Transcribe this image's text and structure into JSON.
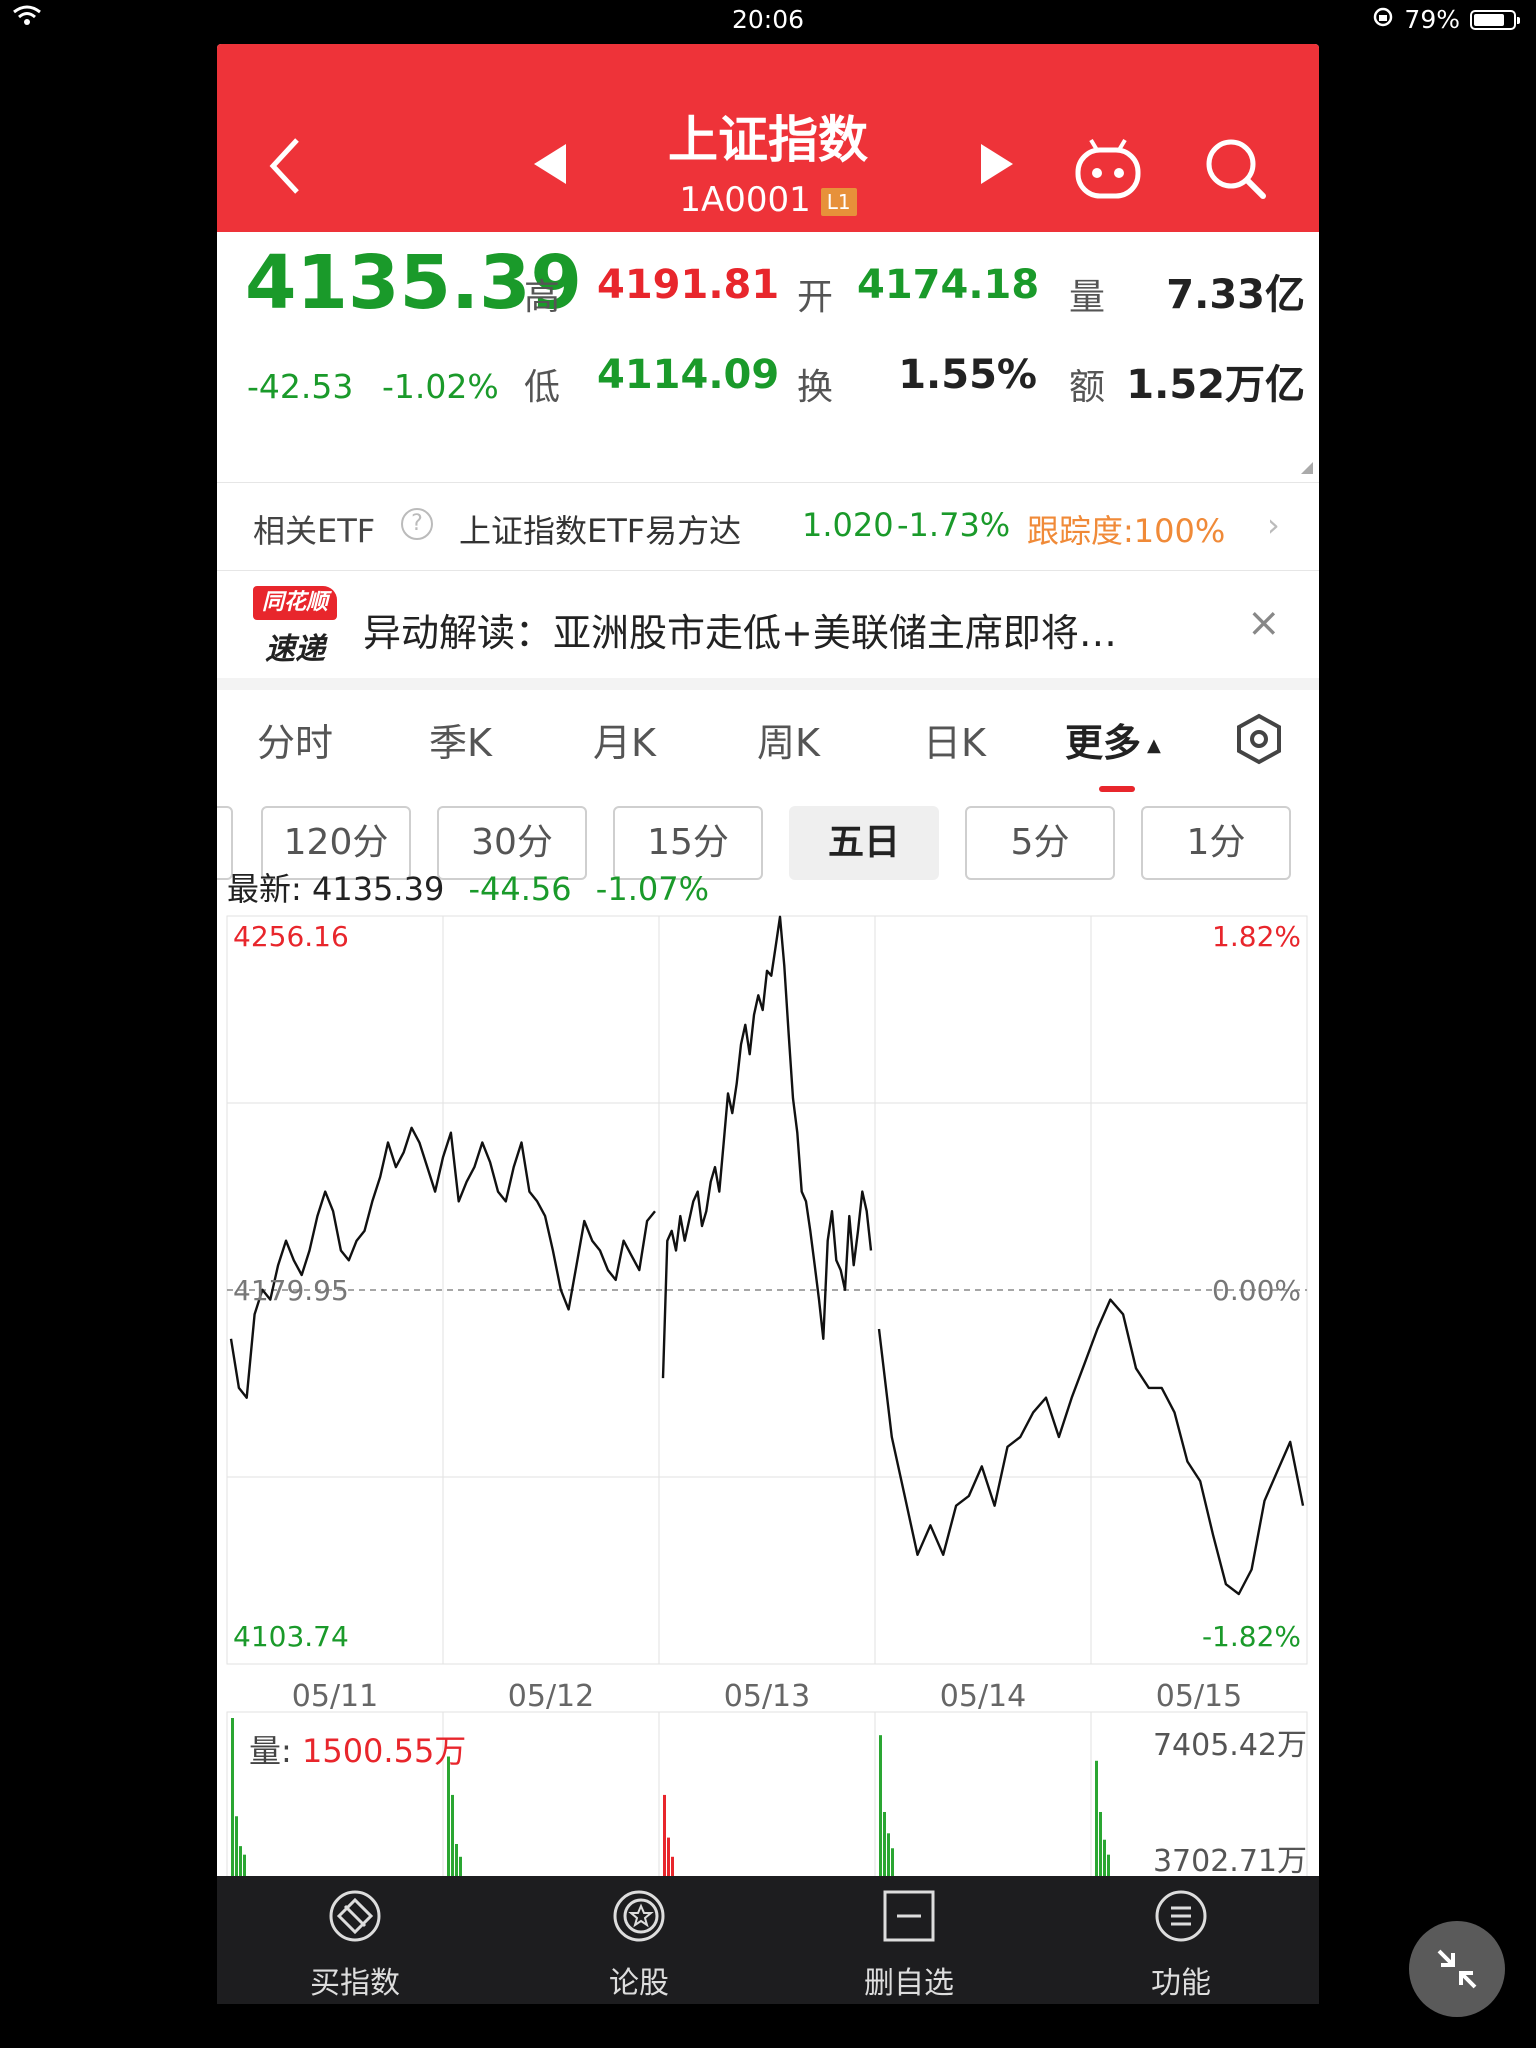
{
  "status": {
    "time": "20:06",
    "battery": "79%",
    "battery_level": 0.79
  },
  "header": {
    "title": "上证指数",
    "code": "1A0001",
    "badge": "L1"
  },
  "quote": {
    "price": "4135.39",
    "change": "-42.53",
    "change_pct": "-1.02%",
    "high_label": "高",
    "high": "4191.81",
    "open_label": "开",
    "open": "4174.18",
    "vol_label": "量",
    "vol": "7.33亿",
    "low_label": "低",
    "low": "4114.09",
    "turnover_label": "换",
    "turnover": "1.55%",
    "amount_label": "额",
    "amount": "1.52万亿"
  },
  "etf": {
    "label": "相关ETF",
    "help": "?",
    "name": "上证指数ETF易方达",
    "price": "1.020",
    "pct": "-1.73%",
    "tracking": "跟踪度:100%"
  },
  "news": {
    "logo_top": "同花顺",
    "logo_bottom": "速递",
    "text": "异动解读：亚洲股市走低+美联储主席即将…",
    "close": "×"
  },
  "tabs": [
    "分时",
    "季K",
    "月K",
    "周K",
    "日K",
    "更多"
  ],
  "active_tab": "更多",
  "subtabs": [
    "120分",
    "30分",
    "15分",
    "五日",
    "5分",
    "1分"
  ],
  "active_subtab": "五日",
  "latest": {
    "label": "最新:",
    "value": "4135.39",
    "chg": "-44.56",
    "pct": "-1.07%"
  },
  "chart_data": {
    "type": "line",
    "series": [
      {
        "values": [
          4170,
          4160,
          4158,
          4175,
          4180,
          4178,
          4185,
          4190,
          4186,
          4183,
          4188,
          4195,
          4200,
          4196,
          4188,
          4186,
          4190,
          4192,
          4198,
          4203,
          4210,
          4205,
          4208,
          4213,
          4210,
          4205,
          4200,
          4207,
          4212,
          4198,
          4202,
          4205,
          4210,
          4206,
          4200,
          4198,
          4205,
          4210,
          4200,
          4198,
          4195,
          4188,
          4180,
          4176,
          4185,
          4194,
          4190,
          4188,
          4184,
          4182,
          4190,
          4187,
          4184,
          4194,
          4196
        ]
      },
      {
        "values": [
          4162,
          4190,
          4192,
          4188,
          4195,
          4190,
          4194,
          4198,
          4200,
          4193,
          4196,
          4202,
          4205,
          4200,
          4210,
          4220,
          4216,
          4222,
          4230,
          4234,
          4228,
          4236,
          4240,
          4237,
          4245,
          4244,
          4250,
          4256,
          4246,
          4232,
          4219,
          4212,
          4200,
          4198,
          4192,
          4185,
          4178,
          4170,
          4190,
          4196,
          4186,
          4184,
          4180,
          4195,
          4185,
          4192,
          4200,
          4196,
          4188
        ]
      },
      {
        "values": [
          4172,
          4150,
          4138,
          4126,
          4132,
          4126,
          4136,
          4138,
          4144,
          4136,
          4148,
          4150,
          4155,
          4158,
          4150,
          4158,
          4165,
          4172,
          4178,
          4175,
          4164,
          4160,
          4160,
          4155,
          4145,
          4141,
          4130,
          4120,
          4118,
          4123,
          4137,
          4143,
          4149,
          4136
        ]
      }
    ],
    "categories": [
      "05/11",
      "05/12",
      "05/13",
      "05/14",
      "05/15"
    ],
    "ylim": [
      4103.74,
      4256.16
    ],
    "y_ticks_left": [
      "4256.16",
      "4179.95",
      "4103.74"
    ],
    "y_ticks_right": [
      "1.82%",
      "0.00%",
      "-1.82%"
    ],
    "reference": 4179.95
  },
  "volume": {
    "label": "量:",
    "value": "1500.55万",
    "max": "7405.42万",
    "mid": "3702.71万",
    "bars": [
      {
        "day": 0,
        "color": "#2aa632",
        "values": [
          7405,
          2800,
          1400,
          1000
        ]
      },
      {
        "day": 1,
        "color": "#2aa632",
        "values": [
          5600,
          3800,
          1500,
          900
        ]
      },
      {
        "day": 2,
        "color": "#e8262c",
        "values": [
          3800,
          1800,
          900
        ]
      },
      {
        "day": 3,
        "color": "#2aa632",
        "values": [
          6600,
          3000,
          2000,
          1300
        ]
      },
      {
        "day": 4,
        "color": "#2aa632",
        "values": [
          5400,
          3000,
          1700,
          1000
        ]
      }
    ]
  },
  "bottom": [
    "买指数",
    "论股",
    "删自选",
    "功能"
  ],
  "colors": {
    "header": "#ee3339",
    "up": "#e8262c",
    "down": "#1a9a2a"
  }
}
